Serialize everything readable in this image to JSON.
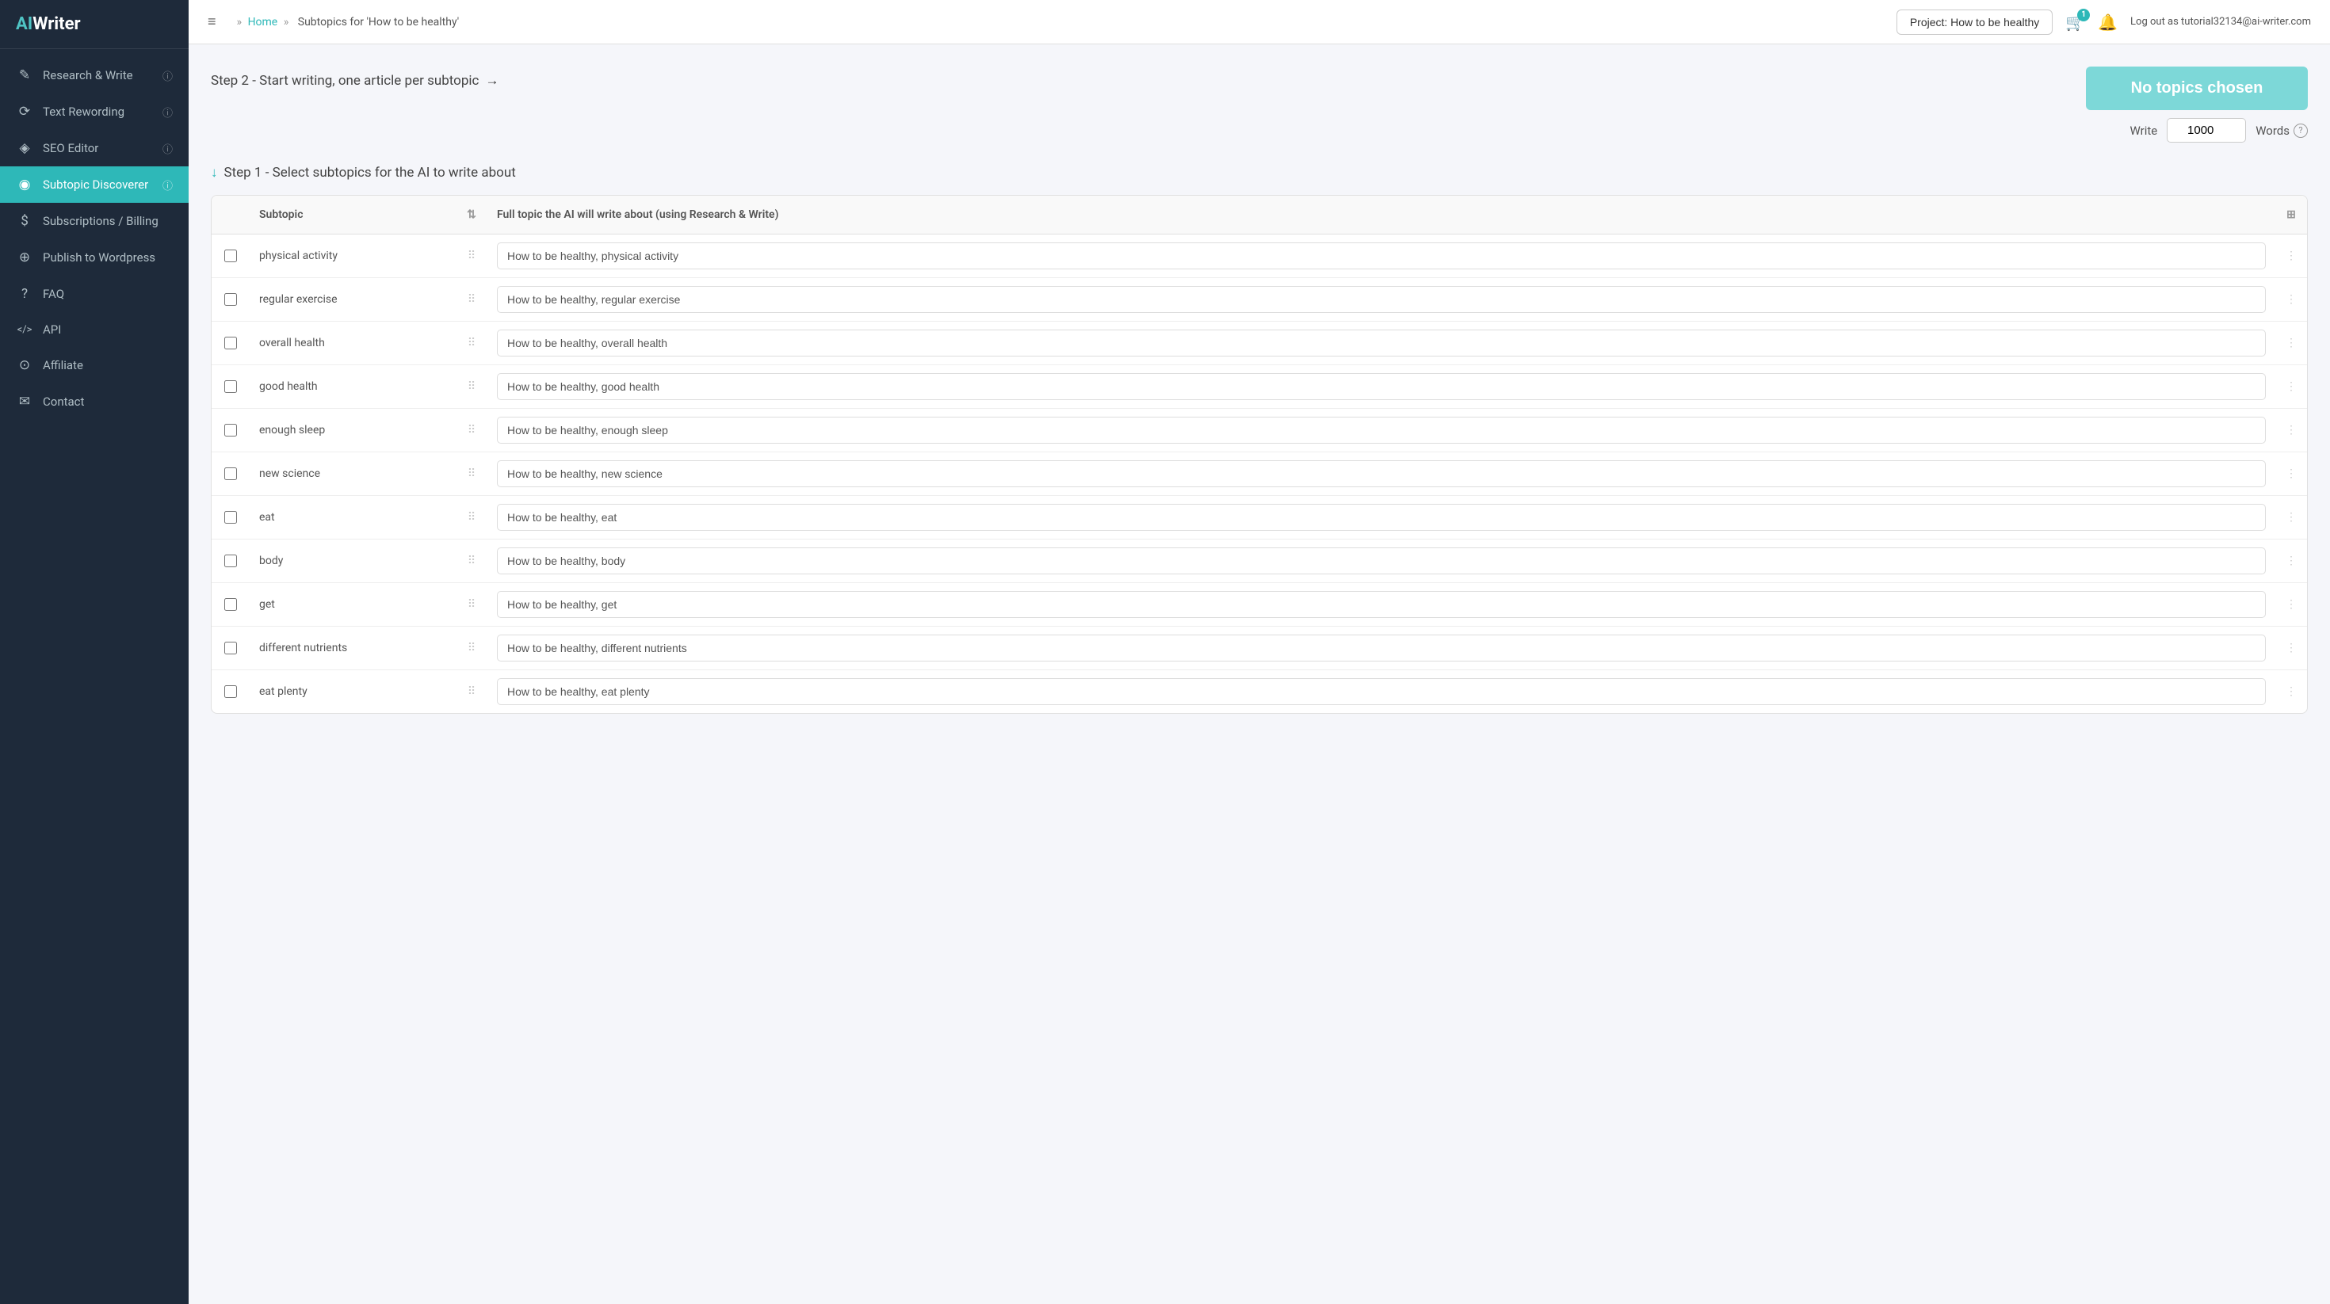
{
  "sidebar": {
    "logo": {
      "ai": "AI",
      "writer": "Writer"
    },
    "items": [
      {
        "id": "research-write",
        "label": "Research & Write",
        "icon": "✎",
        "help": true,
        "active": false
      },
      {
        "id": "text-rewording",
        "label": "Text Rewording",
        "icon": "⟳",
        "help": true,
        "active": false
      },
      {
        "id": "seo-editor",
        "label": "SEO Editor",
        "icon": "◈",
        "help": true,
        "active": false
      },
      {
        "id": "subtopic-discoverer",
        "label": "Subtopic Discoverer",
        "icon": "◉",
        "help": true,
        "active": true
      },
      {
        "id": "subscriptions-billing",
        "label": "Subscriptions / Billing",
        "icon": "$",
        "help": false,
        "active": false
      },
      {
        "id": "publish-wordpress",
        "label": "Publish to Wordpress",
        "icon": "⊕",
        "help": false,
        "active": false
      },
      {
        "id": "faq",
        "label": "FAQ",
        "icon": "?",
        "help": false,
        "active": false
      },
      {
        "id": "api",
        "label": "API",
        "icon": "</>",
        "help": false,
        "active": false
      },
      {
        "id": "affiliate",
        "label": "Affiliate",
        "icon": "⊙",
        "help": false,
        "active": false
      },
      {
        "id": "contact",
        "label": "Contact",
        "icon": "✉",
        "help": false,
        "active": false
      }
    ]
  },
  "header": {
    "menu_icon": "≡",
    "breadcrumb": {
      "prefix": "»",
      "home": "Home",
      "separator": "»",
      "current": "Subtopics for 'How to be healthy'"
    },
    "project_button": "Project: How to be healthy",
    "badge_count": "1",
    "user_text": "Log out as tutorial32134@ai-writer.com"
  },
  "main": {
    "step2": {
      "label": "Step 2 - Start writing, one article per subtopic",
      "arrow": "→"
    },
    "write_button": "No topics chosen",
    "write_label": "Write",
    "words_value": "1000",
    "words_label": "Words",
    "step1": {
      "label": "Step 1 - Select subtopics for the AI to write about",
      "arrow": "↓"
    },
    "table": {
      "col_subtopic": "Subtopic",
      "col_full_topic": "Full topic the AI will write about (using Research & Write)",
      "rows": [
        {
          "subtopic": "physical activity",
          "full_topic": "How to be healthy, physical activity",
          "checked": false
        },
        {
          "subtopic": "regular exercise",
          "full_topic": "How to be healthy, regular exercise",
          "checked": false
        },
        {
          "subtopic": "overall health",
          "full_topic": "How to be healthy, overall health",
          "checked": false
        },
        {
          "subtopic": "good health",
          "full_topic": "How to be healthy, good health",
          "checked": false
        },
        {
          "subtopic": "enough sleep",
          "full_topic": "How to be healthy, enough sleep",
          "checked": false
        },
        {
          "subtopic": "new science",
          "full_topic": "How to be healthy, new science",
          "checked": false
        },
        {
          "subtopic": "eat",
          "full_topic": "How to be healthy, eat",
          "checked": false
        },
        {
          "subtopic": "body",
          "full_topic": "How to be healthy, body",
          "checked": false
        },
        {
          "subtopic": "get",
          "full_topic": "How to be healthy, get",
          "checked": false
        },
        {
          "subtopic": "different nutrients",
          "full_topic": "How to be healthy, different nutrients",
          "checked": false
        },
        {
          "subtopic": "eat plenty",
          "full_topic": "How to be healthy, eat plenty",
          "checked": false
        }
      ]
    }
  }
}
